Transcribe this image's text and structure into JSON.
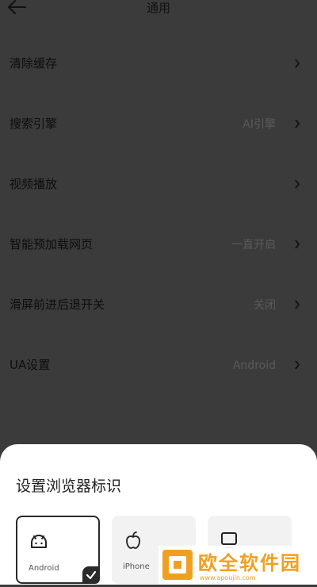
{
  "header": {
    "title": "通用",
    "back_icon": "arrow-left-icon"
  },
  "settings": [
    {
      "label": "清除缓存",
      "value": ""
    },
    {
      "label": "搜索引擎",
      "value": "AI引擎"
    },
    {
      "label": "视频播放",
      "value": ""
    },
    {
      "label": "智能预加载网页",
      "value": "一直开启"
    },
    {
      "label": "滑屏前进后退开关",
      "value": "关闭"
    },
    {
      "label": "UA设置",
      "value": "Android"
    }
  ],
  "sheet": {
    "title": "设置浏览器标识",
    "options": [
      {
        "label": "Android",
        "icon": "android-icon",
        "selected": true
      },
      {
        "label": "iPhone",
        "icon": "apple-icon",
        "selected": false
      },
      {
        "label": "",
        "icon": "desktop-icon",
        "selected": false
      }
    ]
  },
  "watermark": {
    "text": "欧全软件园",
    "url": "www.apoujin.com"
  },
  "colors": {
    "overlay": "#3b3b3b",
    "sheet": "#ffffff",
    "watermark": "#f0a020"
  }
}
